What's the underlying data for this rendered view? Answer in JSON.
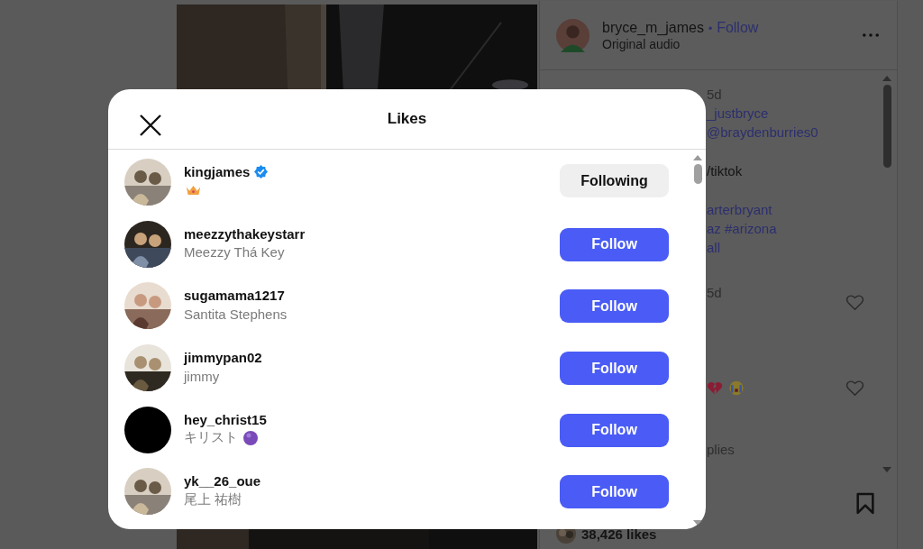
{
  "post": {
    "author": "bryce_m_james",
    "separator": "•",
    "follow": "Follow",
    "audio": "Original audio",
    "comments": [
      {
        "lines": [
          {
            "kind": "meta",
            "text": "5d"
          },
          {
            "kind": "link",
            "text": "_justbryce"
          },
          {
            "kind": "link",
            "text": "@braydenburries0"
          },
          {
            "kind": "text",
            "text": "/tiktok"
          },
          {
            "kind": "link",
            "text": "arterbryant"
          },
          {
            "kind": "link",
            "text": "az #arizona"
          },
          {
            "kind": "link",
            "text": "all"
          }
        ],
        "heart": false
      },
      {
        "lines": [
          {
            "kind": "meta",
            "text": "5d"
          }
        ],
        "heart": true
      },
      {
        "lines": [
          {
            "kind": "emoji"
          }
        ],
        "heart": true
      },
      {
        "lines": [
          {
            "kind": "meta",
            "text": "plies"
          }
        ],
        "heart": false
      }
    ],
    "likes": "38,426 likes"
  },
  "modal": {
    "title": "Likes",
    "rows": [
      {
        "username": "kingjames",
        "verified": true,
        "emoji": true,
        "photo": true,
        "following": true,
        "button": "Following"
      },
      {
        "username": "meezzythakeystarr",
        "subtitle": "Meezzy Thá Key",
        "verified": false,
        "emoji": false,
        "photo": true,
        "following": false,
        "button": "Follow"
      },
      {
        "username": "sugamama1217",
        "subtitle": "Santita Stephens",
        "verified": false,
        "emoji": false,
        "photo": true,
        "following": false,
        "button": "Follow"
      },
      {
        "username": "jimmypan02",
        "subtitle": "jimmy",
        "verified": false,
        "emoji": false,
        "photo": true,
        "following": false,
        "button": "Follow"
      },
      {
        "username": "hey_christ15",
        "subtitle": "キリスト",
        "verified": false,
        "emoji": true,
        "photo": false,
        "following": false,
        "button": "Follow"
      },
      {
        "username": "yk__26_oue",
        "subtitle": "尾上 祐樹",
        "verified": false,
        "emoji": false,
        "photo": true,
        "following": false,
        "button": "Follow"
      }
    ]
  }
}
